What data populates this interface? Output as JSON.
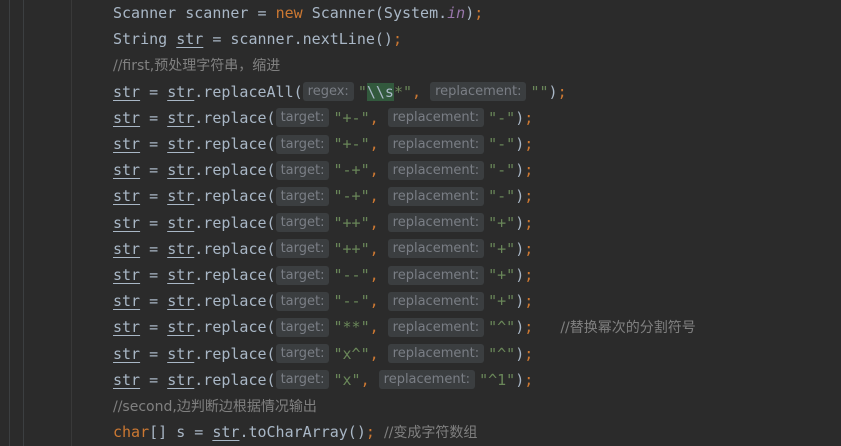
{
  "editor": {
    "lines": [
      {
        "tokens": [
          {
            "t": "Scanner scanner = ",
            "k": "plain"
          },
          {
            "t": "new ",
            "k": "kw"
          },
          {
            "t": "Scanner(System.",
            "k": "plain"
          },
          {
            "t": "in",
            "k": "static"
          },
          {
            "t": ")",
            "k": "plain"
          },
          {
            "t": ";",
            "k": "kw"
          }
        ]
      },
      {
        "tokens": [
          {
            "t": "String ",
            "k": "plain"
          },
          {
            "t": "str",
            "k": "var"
          },
          {
            "t": " = scanner.nextLine()",
            "k": "plain"
          },
          {
            "t": ";",
            "k": "kw"
          }
        ]
      },
      {
        "tokens": [
          {
            "t": "//first,预处理字符串，缩进",
            "k": "cmt"
          }
        ]
      },
      {
        "tokens": [
          {
            "t": "str",
            "k": "var"
          },
          {
            "t": " = ",
            "k": "plain"
          },
          {
            "t": "str",
            "k": "var"
          },
          {
            "t": ".replaceAll(",
            "k": "plain"
          },
          {
            "t": "regex:",
            "k": "hint"
          },
          {
            "t": "\"",
            "k": "str"
          },
          {
            "t": "\\\\s",
            "k": "hl"
          },
          {
            "t": "*\"",
            "k": "str"
          },
          {
            "t": ", ",
            "k": "kw"
          },
          {
            "t": "replacement:",
            "k": "hint"
          },
          {
            "t": "\"\"",
            "k": "str"
          },
          {
            "t": ")",
            "k": "plain"
          },
          {
            "t": ";",
            "k": "kw"
          }
        ]
      },
      {
        "tokens": [
          {
            "t": "str",
            "k": "var"
          },
          {
            "t": " = ",
            "k": "plain"
          },
          {
            "t": "str",
            "k": "var"
          },
          {
            "t": ".replace(",
            "k": "plain"
          },
          {
            "t": "target:",
            "k": "hint"
          },
          {
            "t": "\"+-\"",
            "k": "str"
          },
          {
            "t": ", ",
            "k": "kw"
          },
          {
            "t": "replacement:",
            "k": "hint"
          },
          {
            "t": "\"-\"",
            "k": "str"
          },
          {
            "t": ")",
            "k": "plain"
          },
          {
            "t": ";",
            "k": "kw"
          }
        ]
      },
      {
        "tokens": [
          {
            "t": "str",
            "k": "var"
          },
          {
            "t": " = ",
            "k": "plain"
          },
          {
            "t": "str",
            "k": "var"
          },
          {
            "t": ".replace(",
            "k": "plain"
          },
          {
            "t": "target:",
            "k": "hint"
          },
          {
            "t": "\"+-\"",
            "k": "str"
          },
          {
            "t": ", ",
            "k": "kw"
          },
          {
            "t": "replacement:",
            "k": "hint"
          },
          {
            "t": "\"-\"",
            "k": "str"
          },
          {
            "t": ")",
            "k": "plain"
          },
          {
            "t": ";",
            "k": "kw"
          }
        ]
      },
      {
        "tokens": [
          {
            "t": "str",
            "k": "var"
          },
          {
            "t": " = ",
            "k": "plain"
          },
          {
            "t": "str",
            "k": "var"
          },
          {
            "t": ".replace(",
            "k": "plain"
          },
          {
            "t": "target:",
            "k": "hint"
          },
          {
            "t": "\"-+\"",
            "k": "str"
          },
          {
            "t": ", ",
            "k": "kw"
          },
          {
            "t": "replacement:",
            "k": "hint"
          },
          {
            "t": "\"-\"",
            "k": "str"
          },
          {
            "t": ")",
            "k": "plain"
          },
          {
            "t": ";",
            "k": "kw"
          }
        ]
      },
      {
        "tokens": [
          {
            "t": "str",
            "k": "var"
          },
          {
            "t": " = ",
            "k": "plain"
          },
          {
            "t": "str",
            "k": "var"
          },
          {
            "t": ".replace(",
            "k": "plain"
          },
          {
            "t": "target:",
            "k": "hint"
          },
          {
            "t": "\"-+\"",
            "k": "str"
          },
          {
            "t": ", ",
            "k": "kw"
          },
          {
            "t": "replacement:",
            "k": "hint"
          },
          {
            "t": "\"-\"",
            "k": "str"
          },
          {
            "t": ")",
            "k": "plain"
          },
          {
            "t": ";",
            "k": "kw"
          }
        ]
      },
      {
        "tokens": [
          {
            "t": "str",
            "k": "var"
          },
          {
            "t": " = ",
            "k": "plain"
          },
          {
            "t": "str",
            "k": "var"
          },
          {
            "t": ".replace(",
            "k": "plain"
          },
          {
            "t": "target:",
            "k": "hint"
          },
          {
            "t": "\"++\"",
            "k": "str"
          },
          {
            "t": ", ",
            "k": "kw"
          },
          {
            "t": "replacement:",
            "k": "hint"
          },
          {
            "t": "\"+\"",
            "k": "str"
          },
          {
            "t": ")",
            "k": "plain"
          },
          {
            "t": ";",
            "k": "kw"
          }
        ]
      },
      {
        "tokens": [
          {
            "t": "str",
            "k": "var"
          },
          {
            "t": " = ",
            "k": "plain"
          },
          {
            "t": "str",
            "k": "var"
          },
          {
            "t": ".replace(",
            "k": "plain"
          },
          {
            "t": "target:",
            "k": "hint"
          },
          {
            "t": "\"++\"",
            "k": "str"
          },
          {
            "t": ", ",
            "k": "kw"
          },
          {
            "t": "replacement:",
            "k": "hint"
          },
          {
            "t": "\"+\"",
            "k": "str"
          },
          {
            "t": ")",
            "k": "plain"
          },
          {
            "t": ";",
            "k": "kw"
          }
        ]
      },
      {
        "tokens": [
          {
            "t": "str",
            "k": "var"
          },
          {
            "t": " = ",
            "k": "plain"
          },
          {
            "t": "str",
            "k": "var"
          },
          {
            "t": ".replace(",
            "k": "plain"
          },
          {
            "t": "target:",
            "k": "hint"
          },
          {
            "t": "\"--\"",
            "k": "str"
          },
          {
            "t": ", ",
            "k": "kw"
          },
          {
            "t": "replacement:",
            "k": "hint"
          },
          {
            "t": "\"+\"",
            "k": "str"
          },
          {
            "t": ")",
            "k": "plain"
          },
          {
            "t": ";",
            "k": "kw"
          }
        ]
      },
      {
        "tokens": [
          {
            "t": "str",
            "k": "var"
          },
          {
            "t": " = ",
            "k": "plain"
          },
          {
            "t": "str",
            "k": "var"
          },
          {
            "t": ".replace(",
            "k": "plain"
          },
          {
            "t": "target:",
            "k": "hint"
          },
          {
            "t": "\"--\"",
            "k": "str"
          },
          {
            "t": ", ",
            "k": "kw"
          },
          {
            "t": "replacement:",
            "k": "hint"
          },
          {
            "t": "\"+\"",
            "k": "str"
          },
          {
            "t": ")",
            "k": "plain"
          },
          {
            "t": ";",
            "k": "kw"
          }
        ]
      },
      {
        "tokens": [
          {
            "t": "str",
            "k": "var"
          },
          {
            "t": " = ",
            "k": "plain"
          },
          {
            "t": "str",
            "k": "var"
          },
          {
            "t": ".replace(",
            "k": "plain"
          },
          {
            "t": "target:",
            "k": "hint"
          },
          {
            "t": "\"**\"",
            "k": "str"
          },
          {
            "t": ", ",
            "k": "kw"
          },
          {
            "t": "replacement:",
            "k": "hint"
          },
          {
            "t": "\"^\"",
            "k": "str"
          },
          {
            "t": ")",
            "k": "plain"
          },
          {
            "t": ";",
            "k": "kw"
          },
          {
            "t": "   ",
            "k": "plain"
          },
          {
            "t": "//替换幂次的分割符号",
            "k": "cmt"
          }
        ]
      },
      {
        "tokens": [
          {
            "t": "str",
            "k": "var"
          },
          {
            "t": " = ",
            "k": "plain"
          },
          {
            "t": "str",
            "k": "var"
          },
          {
            "t": ".replace(",
            "k": "plain"
          },
          {
            "t": "target:",
            "k": "hint"
          },
          {
            "t": "\"x^\"",
            "k": "str"
          },
          {
            "t": ", ",
            "k": "kw"
          },
          {
            "t": "replacement:",
            "k": "hint"
          },
          {
            "t": "\"^\"",
            "k": "str"
          },
          {
            "t": ")",
            "k": "plain"
          },
          {
            "t": ";",
            "k": "kw"
          }
        ]
      },
      {
        "tokens": [
          {
            "t": "str",
            "k": "var"
          },
          {
            "t": " = ",
            "k": "plain"
          },
          {
            "t": "str",
            "k": "var"
          },
          {
            "t": ".replace(",
            "k": "plain"
          },
          {
            "t": "target:",
            "k": "hint"
          },
          {
            "t": "\"x\"",
            "k": "str"
          },
          {
            "t": ", ",
            "k": "kw"
          },
          {
            "t": "replacement:",
            "k": "hint"
          },
          {
            "t": "\"^1\"",
            "k": "str"
          },
          {
            "t": ")",
            "k": "plain"
          },
          {
            "t": ";",
            "k": "kw"
          }
        ]
      },
      {
        "tokens": [
          {
            "t": "//second,边判断边根据情况输出",
            "k": "cmt"
          }
        ]
      },
      {
        "tokens": [
          {
            "t": "char",
            "k": "kw"
          },
          {
            "t": "[] s = ",
            "k": "plain"
          },
          {
            "t": "str",
            "k": "var"
          },
          {
            "t": ".toCharArray()",
            "k": "plain"
          },
          {
            "t": "; ",
            "k": "kw"
          },
          {
            "t": "//变成字符数组",
            "k": "cmt"
          }
        ]
      }
    ]
  }
}
